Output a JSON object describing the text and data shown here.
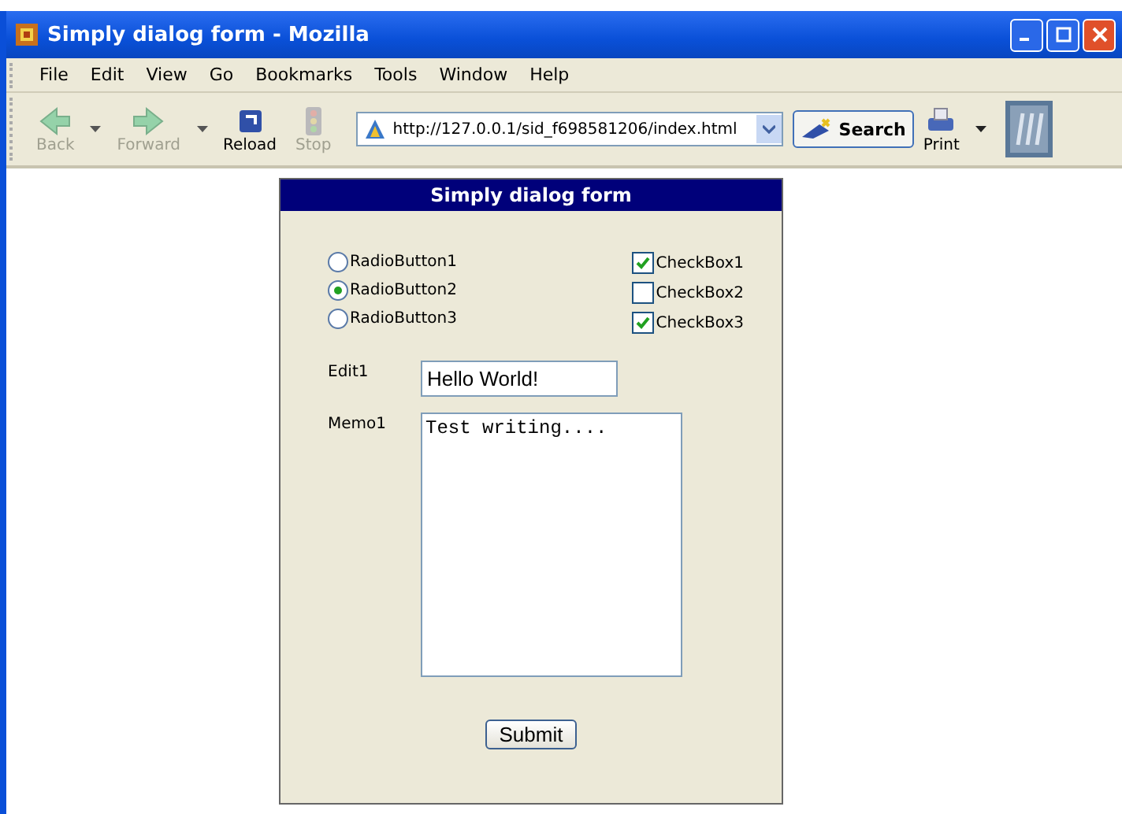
{
  "window": {
    "title": "Simply dialog form - Mozilla"
  },
  "menu": [
    "File",
    "Edit",
    "View",
    "Go",
    "Bookmarks",
    "Tools",
    "Window",
    "Help"
  ],
  "toolbar": [
    {
      "kind": "back",
      "label": "Back",
      "disabled": true,
      "dropdown": true
    },
    {
      "kind": "forward",
      "label": "Forward",
      "disabled": true,
      "dropdown": true
    },
    {
      "kind": "reload",
      "label": "Reload",
      "disabled": false,
      "dropdown": false
    },
    {
      "kind": "stop",
      "label": "Stop",
      "disabled": true,
      "dropdown": false
    }
  ],
  "address": {
    "value": "http://127.0.0.1/sid_f698581206/index.html"
  },
  "search_button": "Search",
  "print_button": {
    "label": "Print"
  },
  "form": {
    "title": "Simply dialog form",
    "radios": [
      {
        "label": "RadioButton1",
        "selected": false
      },
      {
        "label": "RadioButton2",
        "selected": true
      },
      {
        "label": "RadioButton3",
        "selected": false
      }
    ],
    "checkboxes": [
      {
        "label": "CheckBox1",
        "checked": true
      },
      {
        "label": "CheckBox2",
        "checked": false
      },
      {
        "label": "CheckBox3",
        "checked": true
      }
    ],
    "edit": {
      "label": "Edit1",
      "value": "Hello World!"
    },
    "memo": {
      "label": "Memo1",
      "value": "Test writing...."
    },
    "submit": "Submit"
  }
}
